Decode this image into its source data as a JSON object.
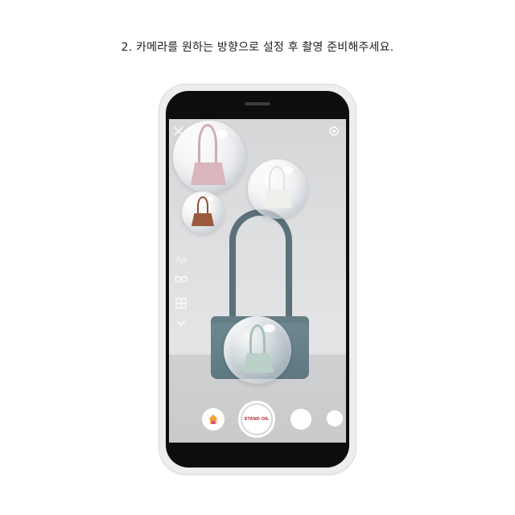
{
  "instruction": "2. 카메라를 원하는 방향으로 설정 후 촬영 준비해주세요.",
  "screen": {
    "top_icons": [
      "close-icon",
      "settings-icon"
    ],
    "left_tools": {
      "text_tool_label": "Aa",
      "icons": [
        "text-tool-icon",
        "infinity-icon",
        "layout-icon",
        "chevron-down-icon"
      ]
    },
    "shutter_label": "STAND OIL",
    "bottom_icons": [
      "home-effect-icon",
      "shutter-button",
      "effect-circle",
      "effect-circle-small"
    ]
  },
  "colors": {
    "main_bag": "#5f7882",
    "pink_bag": "#d9b6bd",
    "brown_bag": "#9a5a3e",
    "white_bag": "#efefec",
    "mint_bag": "#bcd0ca",
    "brand_red": "#b3181f"
  }
}
